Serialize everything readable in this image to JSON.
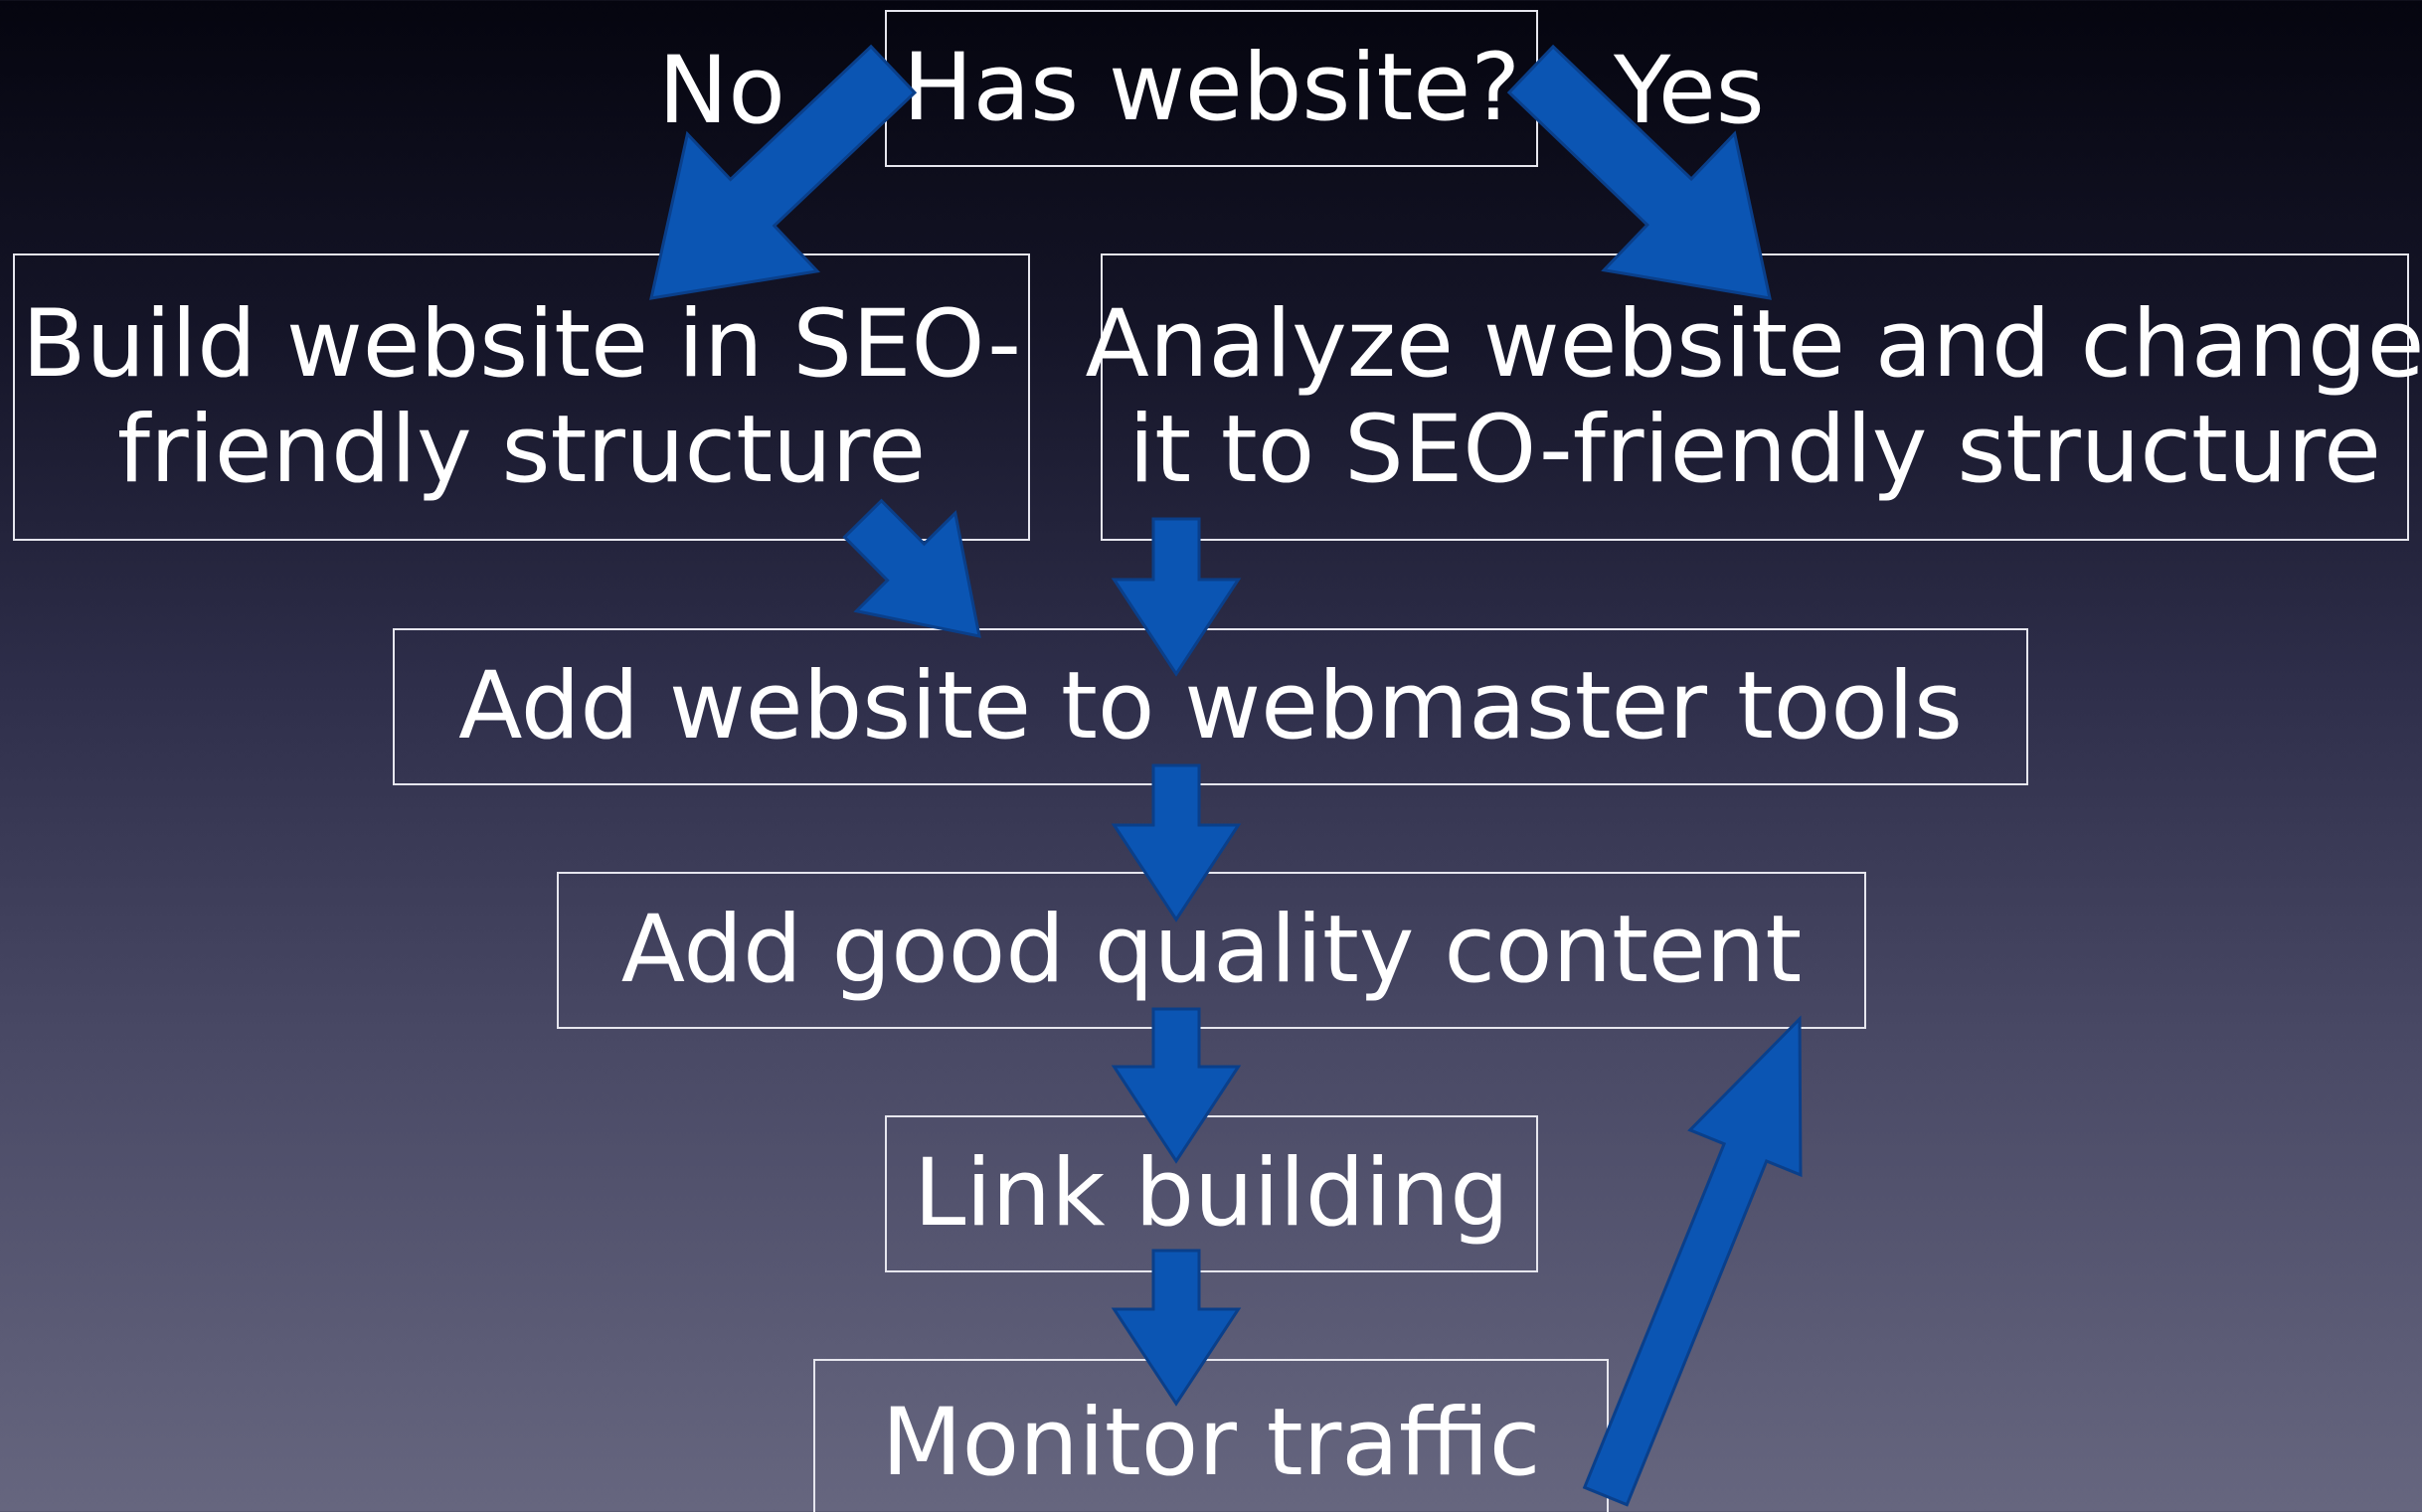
{
  "diagram": {
    "nodes": {
      "has_website": "Has website?",
      "build_line1": "Build website in SEO-",
      "build_line2": "friendly structure",
      "analyze_line1": "Analyze website and change",
      "analyze_line2": "it to SEO-friendly structure",
      "webmaster": "Add website to webmaster tools",
      "content": "Add good quality content",
      "link_building": "Link building",
      "monitor": "Monitor traffic"
    },
    "branch_labels": {
      "no": "No",
      "yes": "Yes"
    },
    "edges": [
      {
        "from": "has_website",
        "to": "build",
        "label": "No"
      },
      {
        "from": "has_website",
        "to": "analyze",
        "label": "Yes"
      },
      {
        "from": "build",
        "to": "webmaster"
      },
      {
        "from": "analyze",
        "to": "webmaster"
      },
      {
        "from": "webmaster",
        "to": "content"
      },
      {
        "from": "content",
        "to": "link_building"
      },
      {
        "from": "link_building",
        "to": "monitor"
      },
      {
        "from": "monitor",
        "to": "content"
      }
    ],
    "colors": {
      "arrow": "#0b55b3",
      "box_border": "#e6e6ee",
      "text": "#ffffff",
      "background_top": "#05050f",
      "background_bottom": "#66667f"
    }
  }
}
